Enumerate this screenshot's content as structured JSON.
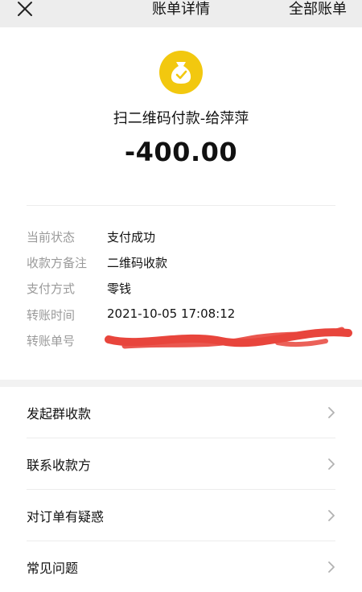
{
  "header": {
    "title": "账单详情",
    "right_link": "全部账单"
  },
  "transaction": {
    "icon": "money-bag-icon",
    "merchant": "扫二维码付款-给萍萍",
    "amount": "-400.00"
  },
  "details": [
    {
      "label": "当前状态",
      "value": "支付成功"
    },
    {
      "label": "收款方备注",
      "value": "二维码收款"
    },
    {
      "label": "支付方式",
      "value": "零钱"
    },
    {
      "label": "转账时间",
      "value": "2021-10-05 17:08:12"
    },
    {
      "label": "转账单号",
      "value": ""
    }
  ],
  "menu": [
    {
      "label": "发起群收款"
    },
    {
      "label": "联系收款方"
    },
    {
      "label": "对订单有疑惑"
    },
    {
      "label": "常见问题"
    }
  ],
  "colors": {
    "accent_yellow": "#f2c80f",
    "redaction": "#e8453c",
    "label_gray": "#9a9a9a"
  }
}
